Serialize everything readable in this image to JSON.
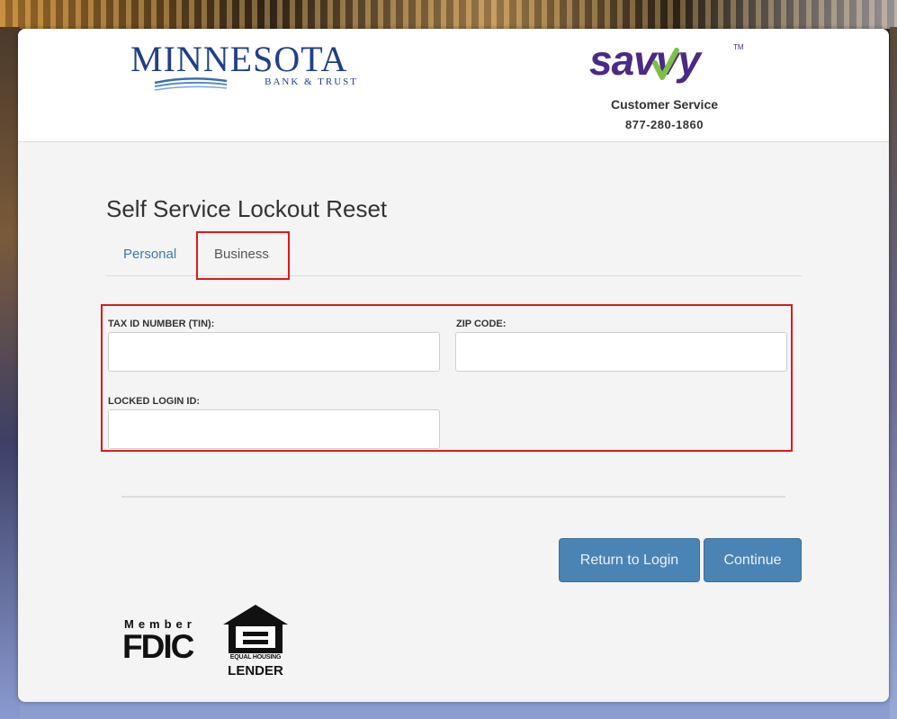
{
  "header": {
    "bank_logo": {
      "name": "MINNESOTA",
      "tagline": "BANK & TRUST",
      "color": "#1f3f8a"
    },
    "savvy_logo": {
      "brand": "savvy",
      "trademark": "TM",
      "color": "#4b2a86",
      "accent": "#7cc242"
    },
    "customer_service": {
      "label": "Customer Service",
      "phone": "877-280-1860"
    }
  },
  "main": {
    "title": "Self Service Lockout Reset",
    "tabs": [
      {
        "label": "Personal",
        "selected": false
      },
      {
        "label": "Business",
        "selected": true
      }
    ],
    "form": {
      "tin": {
        "label": "TAX ID NUMBER (TIN):",
        "value": "",
        "placeholder": ""
      },
      "zip": {
        "label": "ZIP CODE:",
        "value": "",
        "placeholder": ""
      },
      "login_id": {
        "label": "LOCKED LOGIN ID:",
        "value": "",
        "placeholder": ""
      }
    },
    "buttons": {
      "return_label": "Return to Login",
      "continue_label": "Continue"
    }
  },
  "footer": {
    "fdic": {
      "member": "Member",
      "name": "FDIC"
    },
    "equal_housing": {
      "small": "EQUAL HOUSING",
      "big": "LENDER"
    }
  },
  "colors": {
    "highlight": "#e01818",
    "button": "#4a84b4",
    "link": "#3a78b5"
  }
}
